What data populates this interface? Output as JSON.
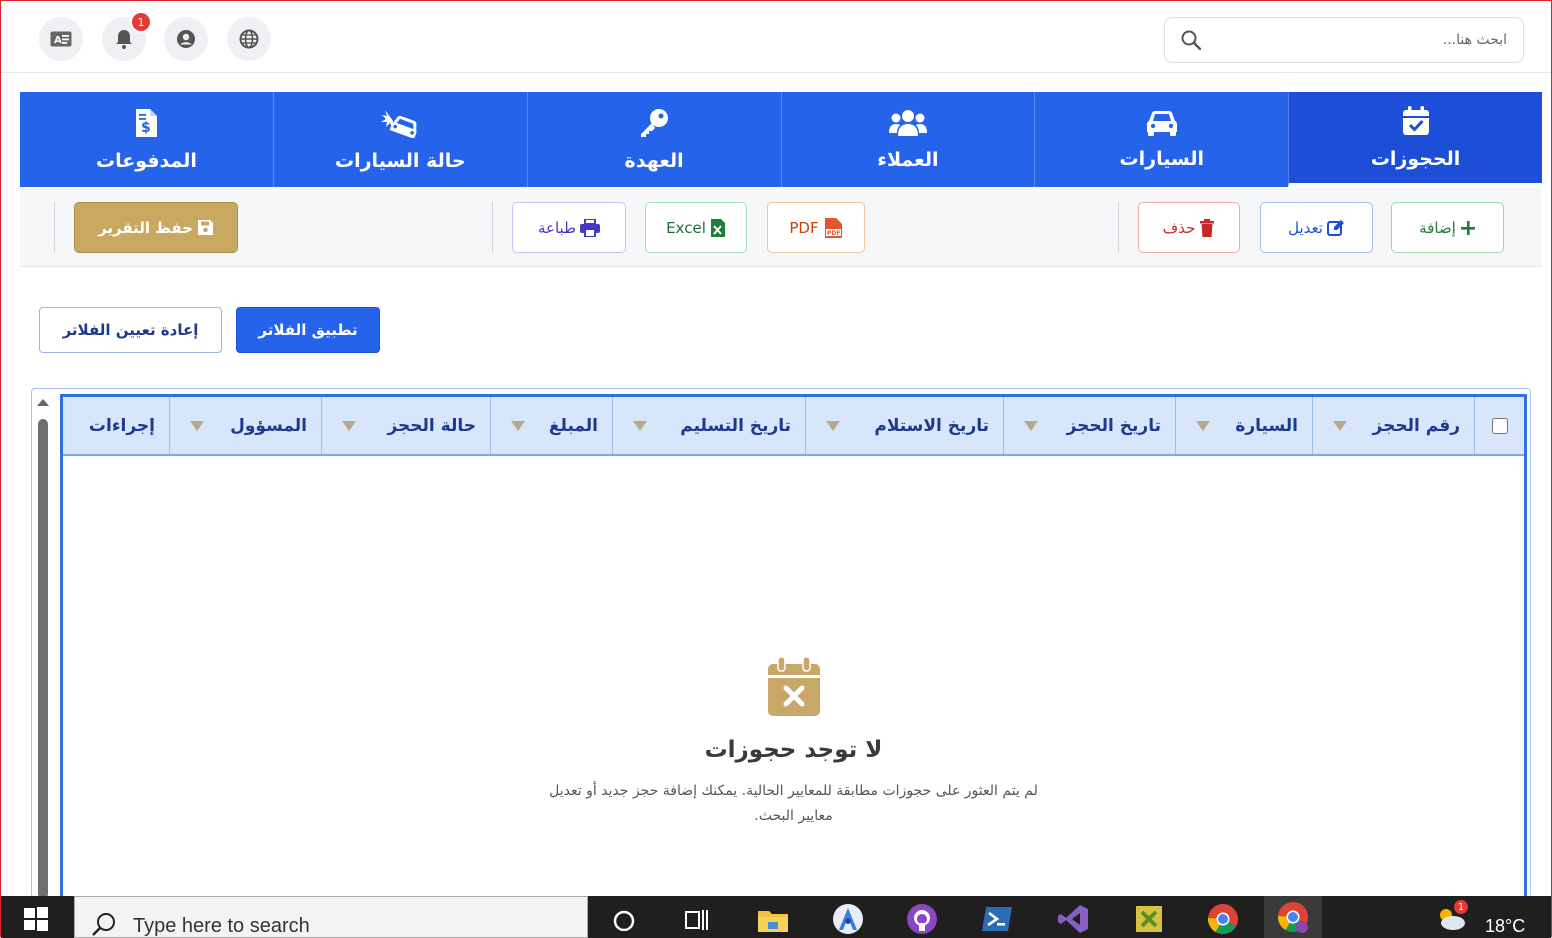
{
  "header": {
    "search_placeholder": "ابحث هنا...",
    "notification_count": "1",
    "icons": [
      "language-icon",
      "notifications-bell-icon",
      "profile-icon",
      "translate-icon"
    ]
  },
  "nav": {
    "tabs": [
      {
        "label": "الحجوزات",
        "icon": "calendar-check-icon",
        "active": true
      },
      {
        "label": "السيارات",
        "icon": "car-icon",
        "active": false
      },
      {
        "label": "العملاء",
        "icon": "users-icon",
        "active": false
      },
      {
        "label": "العهدة",
        "icon": "key-icon",
        "active": false
      },
      {
        "label": "حالة السيارات",
        "icon": "car-crash-icon",
        "active": false
      },
      {
        "label": "المدفوعات",
        "icon": "invoice-dollar-icon",
        "active": false
      }
    ]
  },
  "toolbar": {
    "add": "إضافة",
    "edit": "تعديل",
    "delete": "حذف",
    "pdf": "PDF",
    "excel": "Excel",
    "print": "طباعة",
    "save_report": "حفظ التقرير"
  },
  "filters": {
    "apply": "تطبيق الفلاتر",
    "reset": "إعادة تعيين الفلاتر"
  },
  "table": {
    "columns": [
      "رقم الحجز",
      "السيارة",
      "تاريخ الحجز",
      "تاريخ الاستلام",
      "تاريخ التسليم",
      "المبلغ",
      "حالة الحجز",
      "المسؤول",
      "إجراءات"
    ],
    "rows": [],
    "empty_title": "لا توجد حجوزات",
    "empty_message": "لم يتم العثور على حجوزات مطابقة للمعايير الحالية. يمكنك إضافة حجز جديد أو تعديل معايير البحث."
  },
  "taskbar": {
    "search_placeholder": "Type here to search",
    "temperature": "18°C",
    "weather_badge": "1"
  },
  "colors": {
    "primary": "#2563eb",
    "active_tab": "#1d4ed8",
    "header_bg": "#d8e6fb",
    "gold": "#c8a45e",
    "empty_icon": "#c9a769"
  }
}
